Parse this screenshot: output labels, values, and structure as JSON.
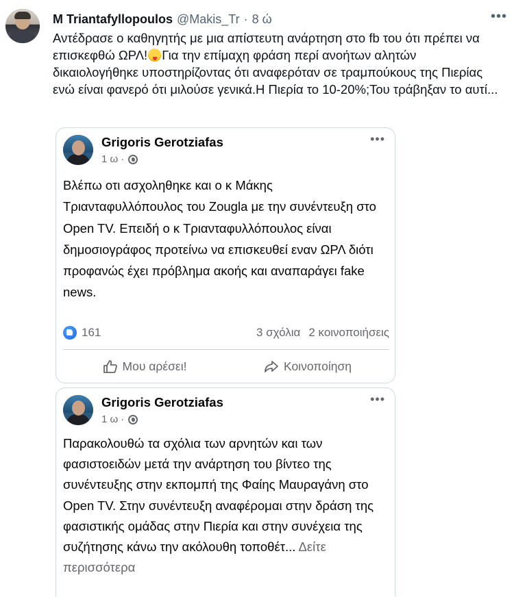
{
  "tweet": {
    "author_name": "M Triantafyllopoulos",
    "author_handle": "@Makis_Tr",
    "separator": "·",
    "time": "8 ώ",
    "more_icon": "more-horizontal-icon",
    "text_part1": "Αντέδρασε ο καθηγητής με μια απίστευτη ανάρτηση στο fb του ότι πρέπει να επισκεφθώ ΩΡΛ!",
    "emoji": "tongue-out-emoji",
    "text_part2": "Για την επίμαχη φράση περί ανοήτων αλητών δικαιολογήθηκε υποστηρίζοντας ότι αναφερόταν σε τραμπούκους της Πιερίας ενώ είναι φανερό ότι μιλούσε γενικά.Η Πιερία το 10-20%;Του τράβηξαν το αυτί..."
  },
  "posts": [
    {
      "author": "Grigoris Gerotziafas",
      "time": "1 ω",
      "separator": "·",
      "visibility_icon": "globe-icon",
      "text": "Βλέπω οτι ασχοληθηκε και ο κ Μάκης Τριανταφυλλόπουλος του Zougla με την συνέντευξη στο Open TV. Επειδή ο κ Τριανταφυλλόπουλος είναι δημοσιογράφος προτείνω να επισκευθεί εναν ΩΡΛ διότι προφανώς έχει πρόβλημα ακοής και αναπαράγει fake news.",
      "reactions": "161",
      "comments": "3 σχόλια",
      "shares": "2 κοινοποιήσεις",
      "like_label": "Μου αρέσει!",
      "share_label": "Κοινοποίηση"
    },
    {
      "author": "Grigoris Gerotziafas",
      "time": "1 ω",
      "separator": "·",
      "visibility_icon": "globe-icon",
      "text": "Παρακολουθώ τα σχόλια των αρνητών και των φασιστοειδών μετά την ανάρτηση του βίντεο της συνέντευξης στην εκπομπή της Φαίης Μαυραγάνη στο Open TV. Στην συνέντευξη αναφέρομαι στην δράση της φασιστικής ομάδας στην Πιερία και στην συνέχεια της συζήτησης κάνω την ακόλουθη τοποθέτ...",
      "see_more": " Δείτε περισσότερα"
    }
  ]
}
